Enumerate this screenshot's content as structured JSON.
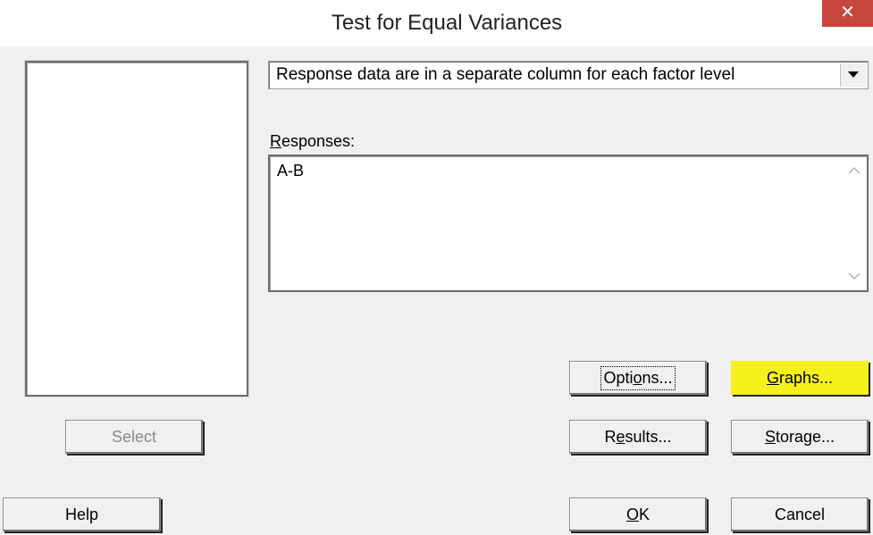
{
  "window": {
    "title": "Test for Equal Variances",
    "close_label": "✕"
  },
  "variable_list": {
    "items": []
  },
  "mode_select": {
    "value": "Response data are in a separate column for each factor level",
    "arrow_icon": "dropdown-arrow-icon"
  },
  "responses": {
    "label_prefix": "",
    "label_underlined": "R",
    "label_rest": "esponses:",
    "value": "A-B"
  },
  "buttons": {
    "select": "Select",
    "help": "Help",
    "options_pre": "Opti",
    "options_u": "o",
    "options_post": "ns...",
    "graphs_pre": "",
    "graphs_u": "G",
    "graphs_post": "raphs...",
    "results_pre": "R",
    "results_u": "e",
    "results_post": "sults...",
    "storage_pre": "",
    "storage_u": "S",
    "storage_post": "torage...",
    "ok_pre": "",
    "ok_u": "O",
    "ok_post": "K",
    "cancel": "Cancel"
  },
  "colors": {
    "highlight": "#f4f21a",
    "close_button": "#c7473f"
  }
}
